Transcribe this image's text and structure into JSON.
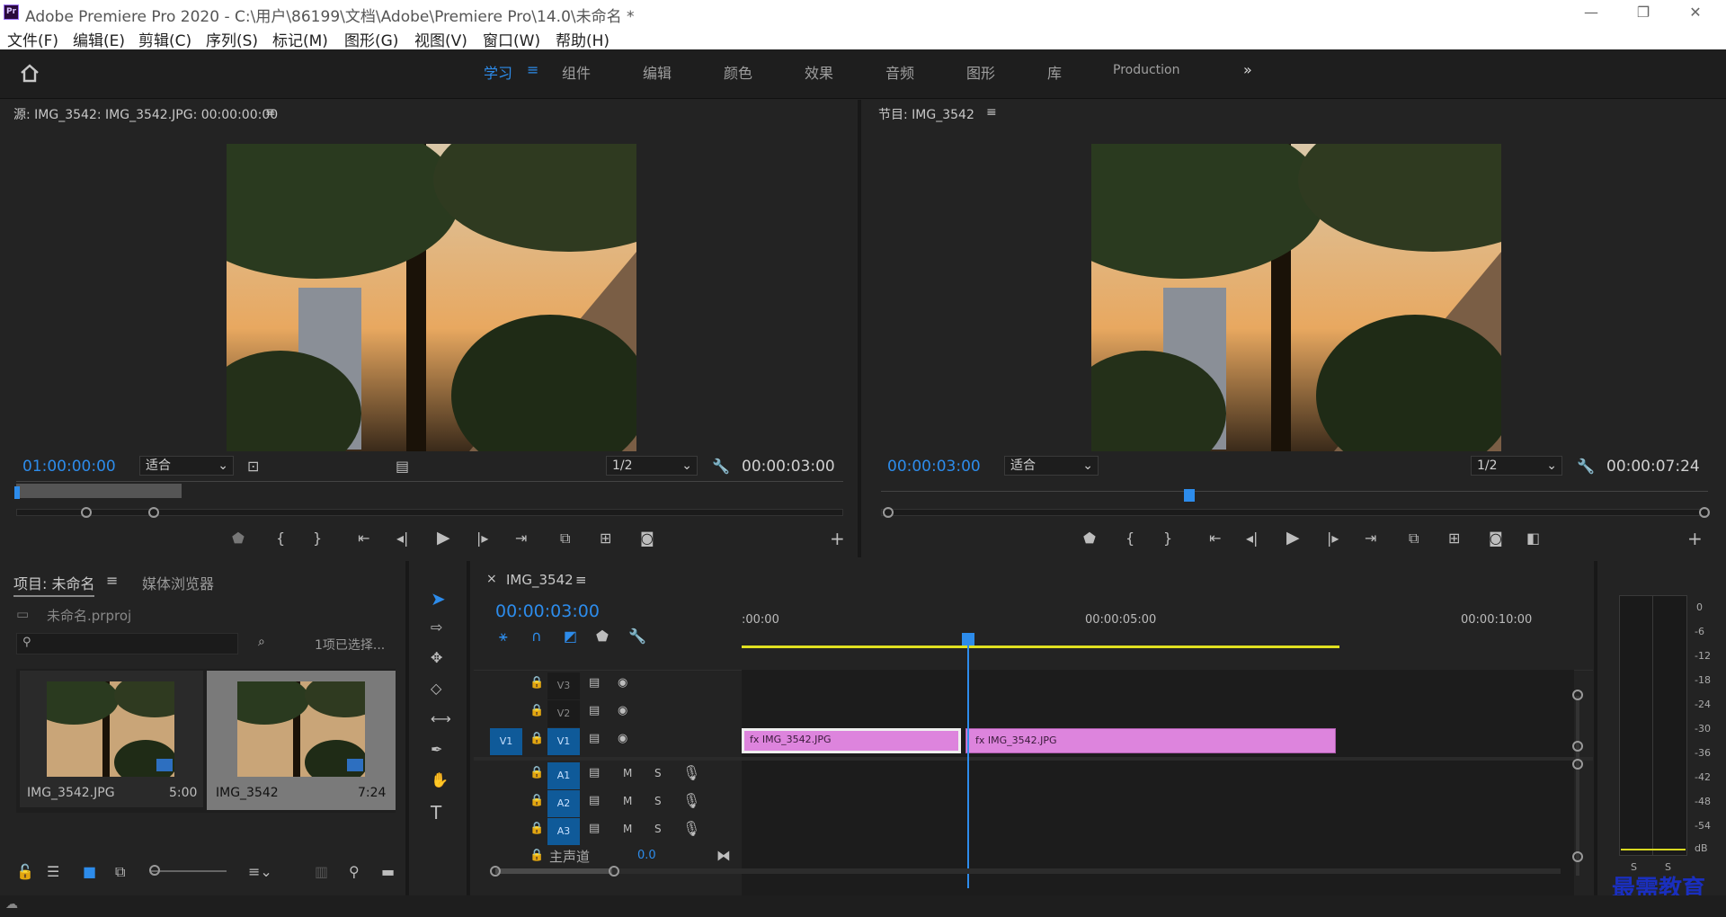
{
  "window": {
    "title": "Adobe Premiere Pro 2020 - C:\\用户\\86199\\文档\\Adobe\\Premiere Pro\\14.0\\未命名 *",
    "app_icon_label": "Pr"
  },
  "menu": [
    "文件(F)",
    "编辑(E)",
    "剪辑(C)",
    "序列(S)",
    "标记(M)",
    "图形(G)",
    "视图(V)",
    "窗口(W)",
    "帮助(H)"
  ],
  "workspaces": {
    "active": "学习",
    "items": [
      "组件",
      "编辑",
      "颜色",
      "效果",
      "音频",
      "图形",
      "库",
      "Production"
    ]
  },
  "source": {
    "title": "源: IMG_3542: IMG_3542.JPG: 00:00:00:00",
    "timecode": "01:00:00:00",
    "fit": "适合",
    "resolution": "1/2",
    "duration": "00:00:03:00"
  },
  "program": {
    "title": "节目: IMG_3542",
    "timecode": "00:00:03:00",
    "fit": "适合",
    "resolution": "1/2",
    "duration": "00:00:07:24"
  },
  "project": {
    "tab_active": "项目: 未命名",
    "tab_other": "媒体浏览器",
    "file": "未命名.prproj",
    "selection": "1项已选择...",
    "items": [
      {
        "name": "IMG_3542.JPG",
        "duration": "5:00"
      },
      {
        "name": "IMG_3542",
        "duration": "7:24"
      }
    ]
  },
  "timeline": {
    "tab": "IMG_3542",
    "timecode": "00:00:03:00",
    "ruler": [
      ":00:00",
      "00:00:05:00",
      "00:00:10:00"
    ],
    "video_tracks": [
      "V3",
      "V2",
      "V1"
    ],
    "audio_tracks": [
      "A1",
      "A2",
      "A3"
    ],
    "source_patch": "V1",
    "master_label": "主声道",
    "master_value": "0.0",
    "clips": [
      {
        "name": "IMG_3542.JPG"
      },
      {
        "name": "IMG_3542.JPG"
      }
    ],
    "mute": "M",
    "solo": "S"
  },
  "meter": {
    "scale": [
      "0",
      "-6",
      "-12",
      "-18",
      "-24",
      "-30",
      "-36",
      "-42",
      "-48",
      "-54",
      "dB"
    ],
    "bottom": [
      "S",
      "S"
    ]
  },
  "watermark": "最需教育",
  "colors": {
    "accent": "#2d8ceb",
    "clip": "#dd84dd",
    "track_target": "#0f5a99",
    "work_area": "#e0e020"
  }
}
